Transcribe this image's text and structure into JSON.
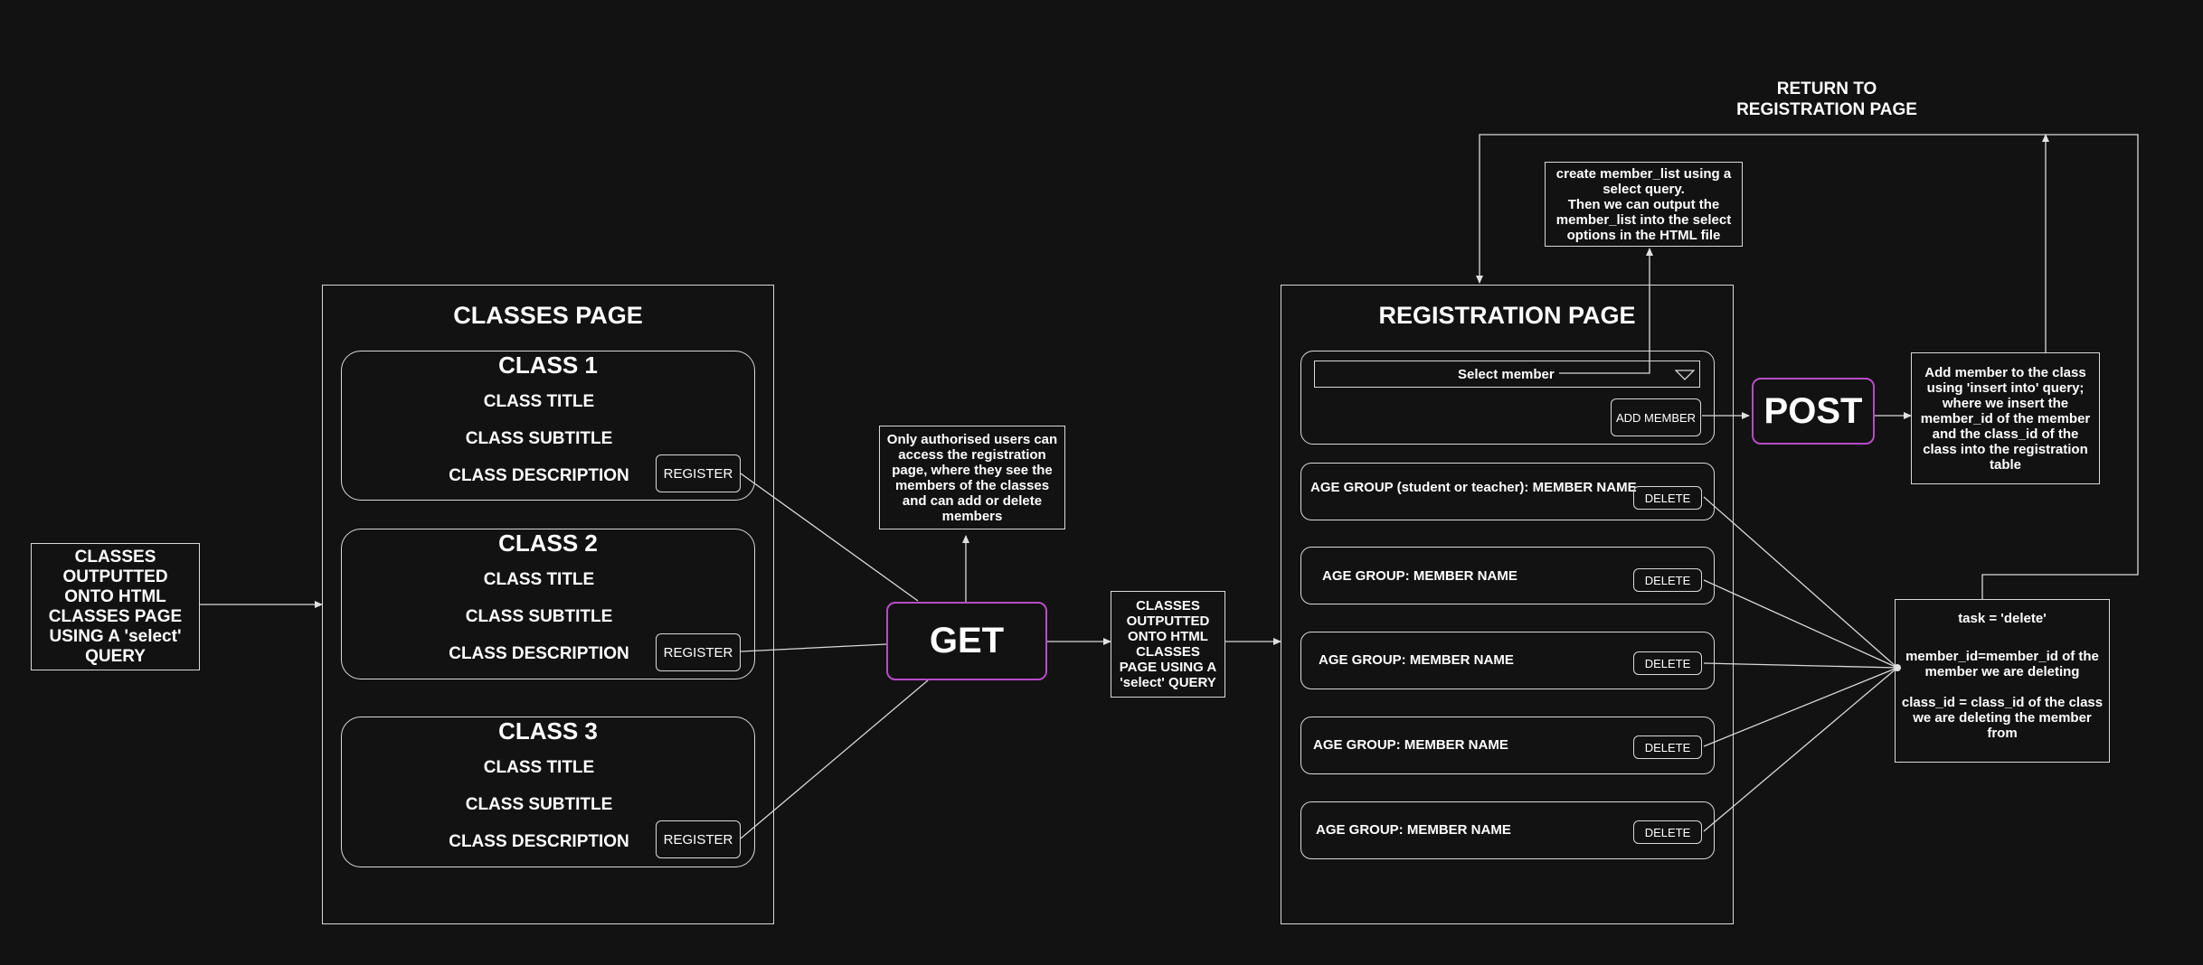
{
  "left_note": "CLASSES OUTPUTTED ONTO HTML CLASSES PAGE USING A 'select' QUERY",
  "classes_page": {
    "title": "CLASSES PAGE",
    "cards": [
      {
        "heading": "CLASS 1",
        "title": "CLASS TITLE",
        "subtitle": "CLASS SUBTITLE",
        "description": "CLASS DESCRIPTION",
        "button": "REGISTER"
      },
      {
        "heading": "CLASS 2",
        "title": "CLASS TITLE",
        "subtitle": "CLASS SUBTITLE",
        "description": "CLASS DESCRIPTION",
        "button": "REGISTER"
      },
      {
        "heading": "CLASS 3",
        "title": "CLASS TITLE",
        "subtitle": "CLASS SUBTITLE",
        "description": "CLASS DESCRIPTION",
        "button": "REGISTER"
      }
    ]
  },
  "auth_note": "Only authorised users can access the registration page, where they see the members of the classes and can add or delete members",
  "get_label": "GET",
  "middle_note": "CLASSES OUTPUTTED ONTO HTML CLASSES PAGE USING A 'select' QUERY",
  "registration_page": {
    "title": "REGISTRATION PAGE",
    "select_placeholder": "Select member",
    "add_button": "ADD MEMBER",
    "rows": [
      {
        "label": "AGE GROUP (student or teacher): MEMBER NAME",
        "button": "DELETE"
      },
      {
        "label": "AGE GROUP: MEMBER NAME",
        "button": "DELETE"
      },
      {
        "label": "AGE GROUP: MEMBER NAME",
        "button": "DELETE"
      },
      {
        "label": "AGE GROUP: MEMBER NAME",
        "button": "DELETE"
      },
      {
        "label": "AGE GROUP: MEMBER NAME",
        "button": "DELETE"
      }
    ]
  },
  "member_list_note": "create member_list using a select query.\nThen we can output the member_list into the select options in the HTML file",
  "return_label": "RETURN TO\nREGISTRATION PAGE",
  "post_label": "POST",
  "insert_note": "Add member to the class using 'insert into' query; where we insert the member_id of the member and the class_id of the class into the registration table",
  "delete_note": {
    "task": "task = 'delete'",
    "member": "member_id=member_id of the member we are deleting",
    "class": "class_id = class_id of the class we are deleting the member from"
  },
  "colors": {
    "background": "#121212",
    "stroke": "#d9d9d9",
    "accent": "#b64dc4"
  }
}
